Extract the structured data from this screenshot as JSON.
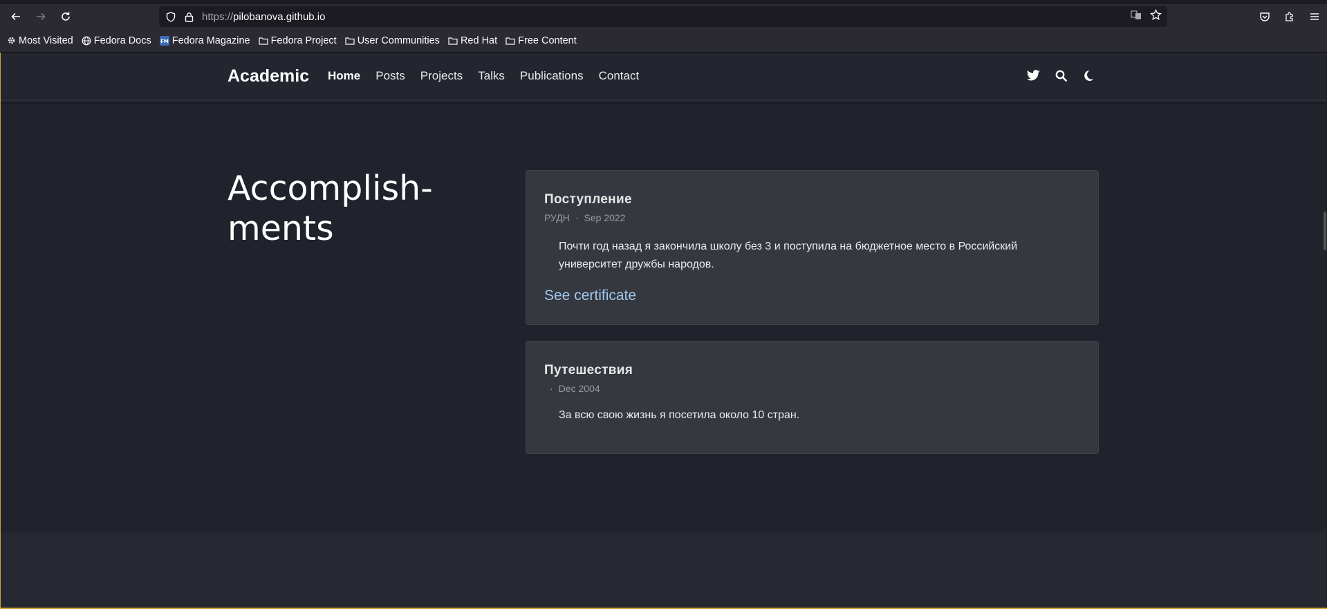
{
  "browser": {
    "url_protocol": "https://",
    "url_host": "pilobanova.github.io",
    "bookmarks": [
      {
        "label": "Most Visited",
        "icon": "gear-icon"
      },
      {
        "label": "Fedora Docs",
        "icon": "globe-icon"
      },
      {
        "label": "Fedora Magazine",
        "icon": "fm-icon"
      },
      {
        "label": "Fedora Project",
        "icon": "folder-icon"
      },
      {
        "label": "User Communities",
        "icon": "folder-icon"
      },
      {
        "label": "Red Hat",
        "icon": "folder-icon"
      },
      {
        "label": "Free Content",
        "icon": "folder-icon"
      }
    ]
  },
  "site": {
    "brand": "Academic",
    "menu": [
      "Home",
      "Posts",
      "Projects",
      "Talks",
      "Publications",
      "Contact"
    ],
    "active": "Home"
  },
  "section": {
    "title_line1": "Accomplish-",
    "title_line2": "ments"
  },
  "cards": [
    {
      "title": "Поступление",
      "org": "РУДН",
      "sep": "·",
      "date": "Sep 2022",
      "body": "Почти год назад я закончила школу без 3 и поступила на бюджетное место в Российский университет дружбы народов.",
      "link": "See certificate"
    },
    {
      "title": "Путешествия",
      "org": "",
      "sep": "·",
      "date": "Dec 2004",
      "body": "За всю свою жизнь я посетила около 10 стран."
    }
  ],
  "colors": {
    "page_bg": "#20232c",
    "card_bg": "#363840",
    "link": "#9fc7ec"
  }
}
